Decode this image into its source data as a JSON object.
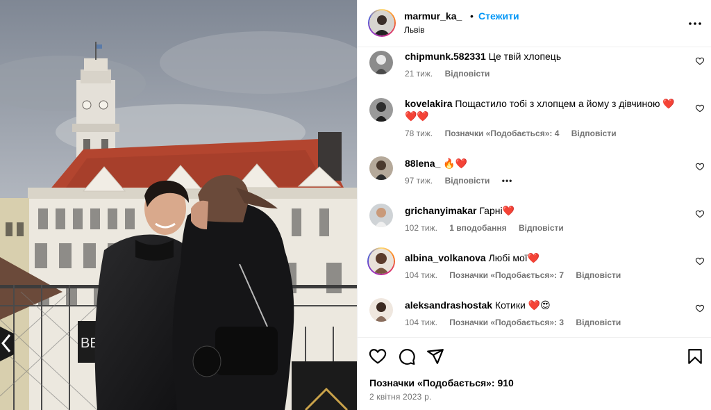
{
  "post": {
    "username": "marmur_ka_",
    "separator": "•",
    "follow_label": "Стежити",
    "location": "Львів"
  },
  "photo": {
    "description_icon": "photo-couple-lviv-town-hall",
    "sign_text": "ВЕР"
  },
  "comments": [
    {
      "user": "chipmunk.582331",
      "text": "Це твій хлопець",
      "time": "21 тиж.",
      "likes": "",
      "reply": "Відповісти",
      "extra": ""
    },
    {
      "user": "kovelakira",
      "text": "Пощастило тобі з хлопцем а йому з дівчиною ❤️❤️❤️",
      "time": "78 тиж.",
      "likes": "Позначки «Подобається»: 4",
      "reply": "Відповісти",
      "extra": ""
    },
    {
      "user": "88lena_",
      "text": "🔥❤️",
      "time": "97 тиж.",
      "likes": "",
      "reply": "Відповісти",
      "extra": "•••"
    },
    {
      "user": "grichanyimakar",
      "text": "Гарні❤️",
      "time": "102 тиж.",
      "likes": "1 вподобання",
      "reply": "Відповісти",
      "extra": ""
    },
    {
      "user": "albina_volkanova",
      "text": "Любі мої❤️",
      "time": "104 тиж.",
      "likes": "Позначки «Подобається»: 7",
      "reply": "Відповісти",
      "extra": ""
    },
    {
      "user": "aleksandrashostak",
      "text": "Котики ❤️😍",
      "time": "104 тиж.",
      "likes": "Позначки «Подобається»: 3",
      "reply": "Відповісти",
      "extra": ""
    }
  ],
  "footer": {
    "likes": "Позначки «Подобається»: 910",
    "date": "2 квітня 2023 р."
  },
  "icons": {
    "like": "heart-icon",
    "comment": "comment-icon",
    "share": "share-icon",
    "save": "bookmark-icon",
    "more": "more-horizontal-icon"
  },
  "colors": {
    "link": "#0095f6",
    "muted": "#737373",
    "border": "#efefef"
  }
}
